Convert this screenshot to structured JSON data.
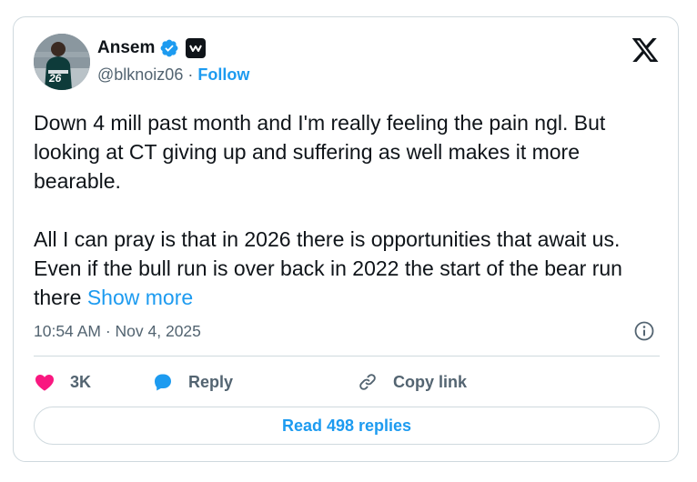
{
  "author": {
    "name": "Ansem",
    "handle": "@blknoiz06",
    "separator": "·",
    "follow_label": "Follow",
    "verified_icon": "verified-badge-icon",
    "affiliation_icon": "affiliation-badge-icon",
    "avatar_jersey_number": "26"
  },
  "brand": {
    "logo_icon": "x-logo-icon"
  },
  "tweet": {
    "paragraph_1": "Down 4 mill past month and I'm really feeling the pain ngl. But looking at CT giving up and suffering as well makes it more bearable.",
    "paragraph_2": "All I can pray is that in 2026 there is opportunities that await us. Even if the bull run is over back in 2022 the start of the bear run there",
    "show_more_label": "Show more",
    "time": "10:54 AM",
    "separator": "·",
    "date": "Nov 4, 2025"
  },
  "actions": {
    "like_count": "3K",
    "reply_label": "Reply",
    "copy_link_label": "Copy link",
    "read_replies_label": "Read 498 replies"
  },
  "colors": {
    "accent": "#1d9bf0",
    "like": "#f91880",
    "text": "#0f1419",
    "secondary_text": "#536471",
    "border": "#cfd9de"
  }
}
